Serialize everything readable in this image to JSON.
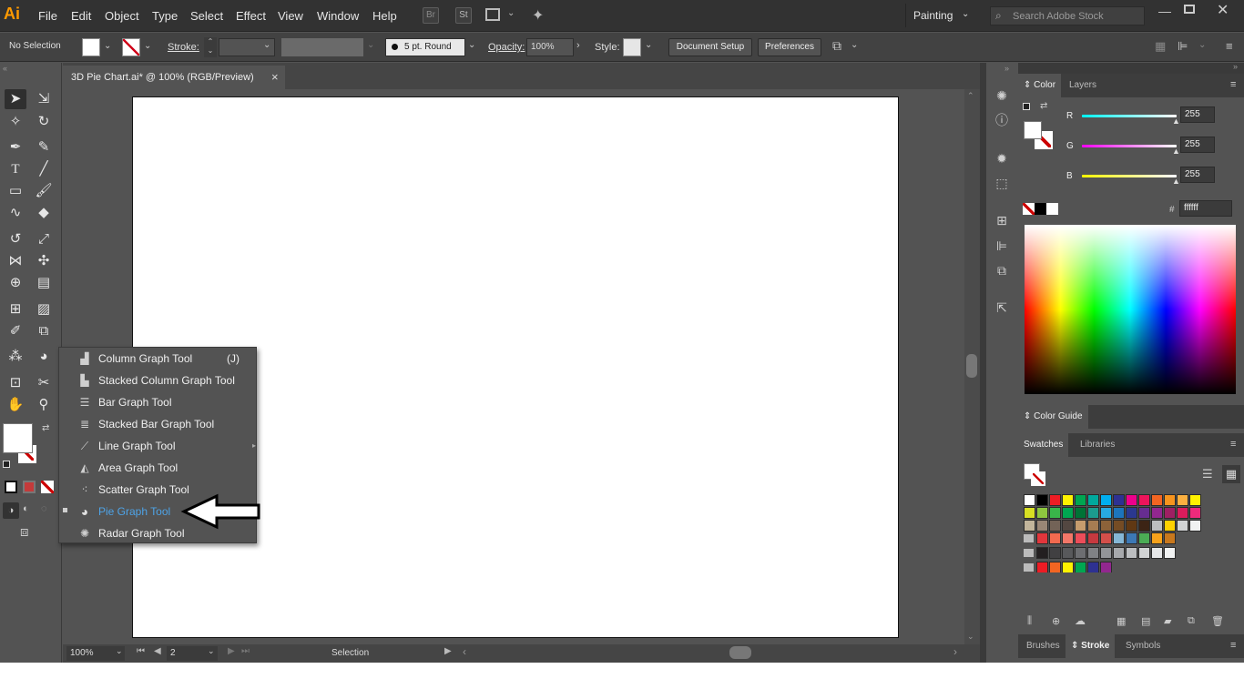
{
  "app": {
    "logo": "Ai",
    "workspace": "Painting",
    "search_placeholder": "Search Adobe Stock",
    "br_label": "Br",
    "st_label": "St"
  },
  "menu": [
    "File",
    "Edit",
    "Object",
    "Type",
    "Select",
    "Effect",
    "View",
    "Window",
    "Help"
  ],
  "control": {
    "selection": "No Selection",
    "stroke_label": "Stroke:",
    "brush": "5 pt. Round",
    "opacity_label": "Opacity:",
    "opacity": "100%",
    "style_label": "Style:",
    "doc_setup": "Document Setup",
    "preferences": "Preferences"
  },
  "document": {
    "tab_title": "3D Pie Chart.ai* @ 100% (RGB/Preview)",
    "close": "×"
  },
  "status": {
    "zoom": "100%",
    "page": "2",
    "tool": "Selection"
  },
  "flyout": {
    "items": [
      {
        "label": "Column Graph Tool",
        "shortcut": "(J)"
      },
      {
        "label": "Stacked Column Graph Tool"
      },
      {
        "label": "Bar Graph Tool"
      },
      {
        "label": "Stacked Bar Graph Tool"
      },
      {
        "label": "Line Graph Tool"
      },
      {
        "label": "Area Graph Tool"
      },
      {
        "label": "Scatter Graph Tool"
      },
      {
        "label": "Pie Graph Tool"
      },
      {
        "label": "Radar Graph Tool"
      }
    ],
    "highlight_color": "#4ea3e6"
  },
  "panels": {
    "color_tab": "Color",
    "layers_tab": "Layers",
    "r_label": "R",
    "g_label": "G",
    "b_label": "B",
    "r_value": "255",
    "g_value": "255",
    "b_value": "255",
    "hash": "#",
    "hex": "ffffff",
    "color_guide": "Color Guide",
    "swatches_tab": "Swatches",
    "libraries_tab": "Libraries",
    "brushes_tab": "Brushes",
    "stroke_tab": "Stroke",
    "symbols_tab": "Symbols"
  },
  "swatch_rows": [
    [
      "#ffffff",
      "#000000",
      "#ed1c24",
      "#fff200",
      "#00a651",
      "#00a99d",
      "#00aeef",
      "#2e3192",
      "#ec008c",
      "#ed145b",
      "#f26522",
      "#f7941d",
      "#fbb040",
      "#fff200"
    ],
    [
      "#d7df23",
      "#8dc63f",
      "#39b54a",
      "#00a651",
      "#007236",
      "#1b9b8e",
      "#27aae1",
      "#1c75bc",
      "#2b388f",
      "#662d91",
      "#92278f",
      "#9e1f63",
      "#da1c5c",
      "#ee2a7b"
    ],
    [
      "#c2b59b",
      "#998675",
      "#736357",
      "#534741",
      "#c69c6d",
      "#a67c52",
      "#8c6239",
      "#754c24",
      "#603813",
      "#3c2415",
      "#bcbec0",
      "#ffd200",
      "#d1d3d4",
      "#f1f2f2"
    ],
    [
      "#e2363c",
      "#f26a4f",
      "#f37768",
      "#ec4d59",
      "#c6393f",
      "#d44f4a",
      "#85b7d6",
      "#3c78b4",
      "#4bac55",
      "#f7a21b",
      "#c8781d"
    ],
    [
      "#231f20",
      "#414042",
      "#58595b",
      "#6d6e71",
      "#808285",
      "#939598",
      "#a7a9ac",
      "#bcbec0",
      "#d1d3d4",
      "#e6e7e8",
      "#f1f2f2"
    ],
    [
      "#ed1c24",
      "#f26522",
      "#fff200",
      "#00a651",
      "#2e3192",
      "#92278f"
    ]
  ]
}
